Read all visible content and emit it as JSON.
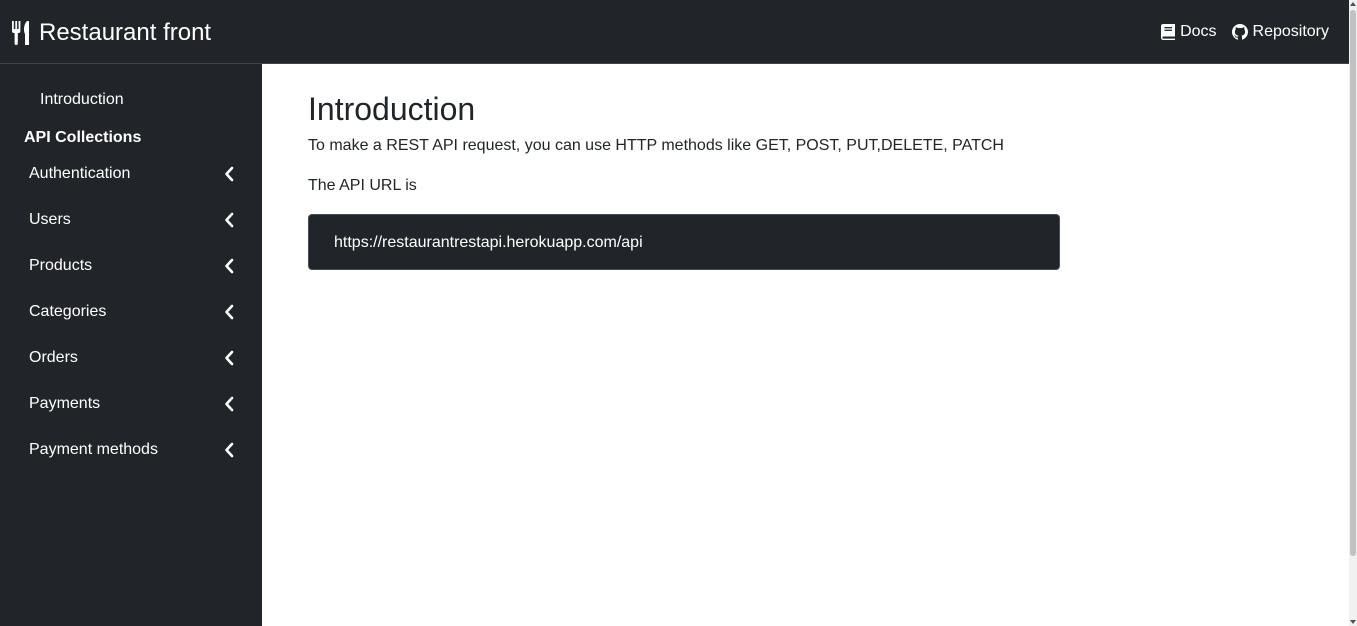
{
  "navbar": {
    "brand_icon": "utensils-icon",
    "brand_title": "Restaurant front",
    "links": [
      {
        "icon": "book-icon",
        "label": "Docs"
      },
      {
        "icon": "github-icon",
        "label": "Repository"
      }
    ]
  },
  "sidebar": {
    "intro_label": "Introduction",
    "section_title": "API Collections",
    "items": [
      {
        "label": "Authentication",
        "icon": "chevron-left-icon"
      },
      {
        "label": "Users",
        "icon": "chevron-left-icon"
      },
      {
        "label": "Products",
        "icon": "chevron-left-icon"
      },
      {
        "label": "Categories",
        "icon": "chevron-left-icon"
      },
      {
        "label": "Orders",
        "icon": "chevron-left-icon"
      },
      {
        "label": "Payments",
        "icon": "chevron-left-icon"
      },
      {
        "label": "Payment methods",
        "icon": "chevron-left-icon"
      }
    ]
  },
  "main": {
    "title": "Introduction",
    "paragraph1": "To make a REST API request, you can use HTTP methods like GET, POST, PUT,DELETE, PATCH",
    "paragraph2": "The API URL is",
    "api_url": "https://restaurantrestapi.herokuapp.com/api"
  },
  "colors": {
    "dark_background": "#212529",
    "text": "#212529",
    "light_text": "#ffffff"
  }
}
